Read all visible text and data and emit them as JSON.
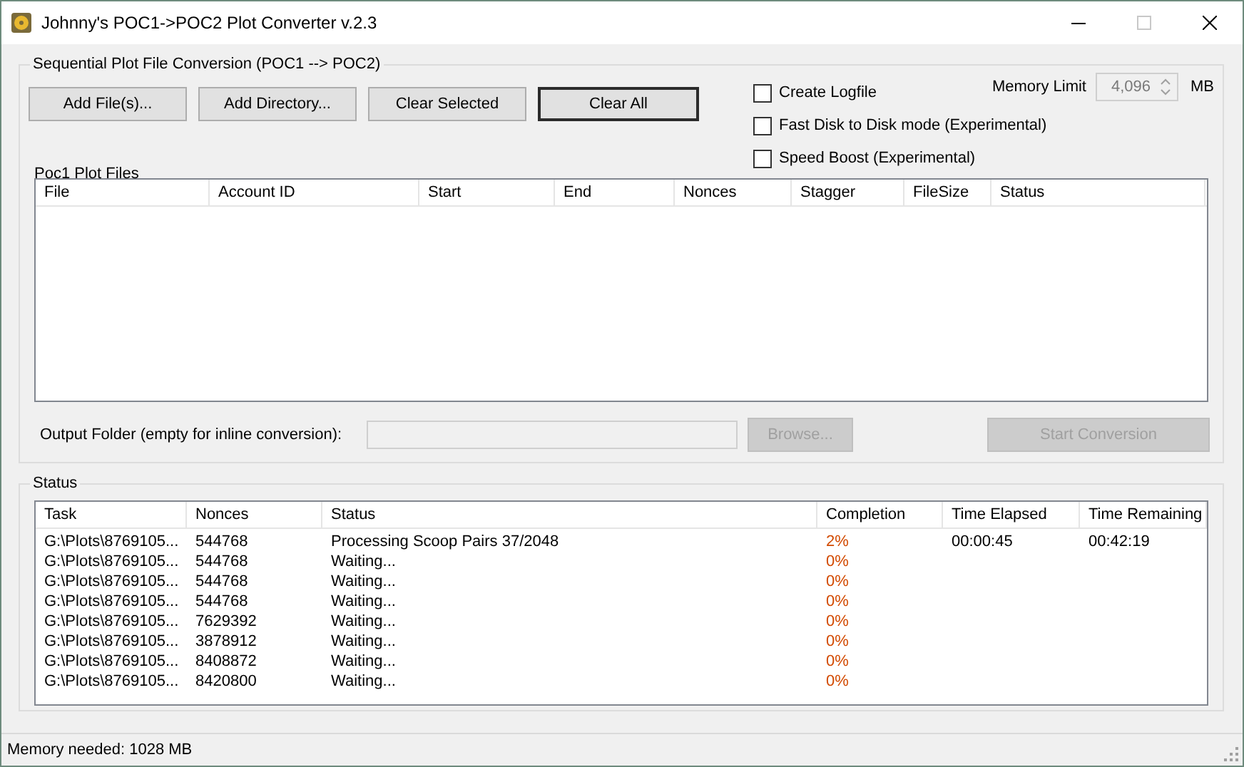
{
  "window": {
    "title": "Johnny's POC1->POC2 Plot Converter v.2.3"
  },
  "conversion_group": {
    "legend": "Sequential Plot File Conversion (POC1 --> POC2)",
    "buttons": [
      {
        "label": "Add File(s)...",
        "default": false
      },
      {
        "label": "Add Directory...",
        "default": false
      },
      {
        "label": "Clear Selected",
        "default": false
      },
      {
        "label": "Clear All",
        "default": true
      }
    ],
    "options": [
      {
        "label": "Create Logfile",
        "checked": false
      },
      {
        "label": "Fast Disk to Disk mode (Experimental)",
        "checked": false
      },
      {
        "label": "Speed Boost (Experimental)",
        "checked": false
      }
    ],
    "memory_limit": {
      "label": "Memory Limit",
      "value": "4,096",
      "unit": "MB",
      "disabled": true
    },
    "files_label": "Poc1 Plot Files",
    "files_table": {
      "columns": [
        "File",
        "Account ID",
        "Start",
        "End",
        "Nonces",
        "Stagger",
        "FileSize",
        "Status"
      ]
    },
    "output_folder": {
      "label": "Output Folder (empty for inline conversion):",
      "disabled": true
    },
    "browse_button": {
      "label": "Browse...",
      "disabled": true
    },
    "start_button": {
      "label": "Start Conversion",
      "disabled": true
    }
  },
  "status_group": {
    "legend": "Status",
    "table": {
      "columns": [
        "Task",
        "Nonces",
        "Status",
        "Completion",
        "Time Elapsed",
        "Time Remaining"
      ],
      "rows": [
        {
          "task": "G:\\Plots\\8769105...",
          "nonces": "544768",
          "status": "Processing Scoop Pairs 37/2048",
          "completion": "2%",
          "time_elapsed": "00:00:45",
          "time_remaining": "00:42:19"
        },
        {
          "task": "G:\\Plots\\8769105...",
          "nonces": "544768",
          "status": "Waiting...",
          "completion": "0%"
        },
        {
          "task": "G:\\Plots\\8769105...",
          "nonces": "544768",
          "status": "Waiting...",
          "completion": "0%"
        },
        {
          "task": "G:\\Plots\\8769105...",
          "nonces": "544768",
          "status": "Waiting...",
          "completion": "0%"
        },
        {
          "task": "G:\\Plots\\8769105...",
          "nonces": "7629392",
          "status": "Waiting...",
          "completion": "0%"
        },
        {
          "task": "G:\\Plots\\8769105...",
          "nonces": "3878912",
          "status": "Waiting...",
          "completion": "0%"
        },
        {
          "task": "G:\\Plots\\8769105...",
          "nonces": "8408872",
          "status": "Waiting...",
          "completion": "0%"
        },
        {
          "task": "G:\\Plots\\8769105...",
          "nonces": "8420800",
          "status": "Waiting...",
          "completion": "0%"
        }
      ]
    }
  },
  "status_bar": {
    "text": "Memory needed: 1028 MB"
  }
}
